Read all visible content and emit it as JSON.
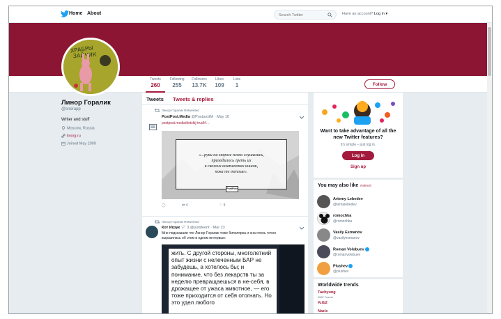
{
  "nav": {
    "home": "Home",
    "about": "About",
    "search_placeholder": "Search Twitter",
    "have_account": "Have an account?",
    "login": "Log in ▾"
  },
  "stats": [
    {
      "label": "Tweets",
      "value": "260"
    },
    {
      "label": "Following",
      "value": "255"
    },
    {
      "label": "Followers",
      "value": "13.7K"
    },
    {
      "label": "Likes",
      "value": "109"
    },
    {
      "label": "Lists",
      "value": "1"
    }
  ],
  "follow_label": "Follow",
  "profile": {
    "name": "Линор Горалик",
    "handle": "@snorapp",
    "bio": "Writer and stuff",
    "location": "Moscow, Russia",
    "website": "linorg.ru",
    "joined": "Joined May 2009"
  },
  "timeline": {
    "tab_tweets": "Tweets",
    "tab_replies": "Tweets & replies"
  },
  "tweet1": {
    "retweeted_by": "Линор Горалик Retweeted",
    "author": "PostPost.Media",
    "handle_date": "@PostpostM · May 16",
    "link": "postpost.media/detskij-trud/#…",
    "quote_line1": "«...руки на морозе плохо слушались,",
    "quote_line2": "приходилось греть их",
    "quote_line3": "в свежих комплектах кишок,",
    "quote_line4": "пока те теплые».",
    "quote_badge": "PostPost",
    "retweets": "4",
    "likes": "9"
  },
  "tweet2": {
    "retweeted_by": "Линор Горалик Retweeted",
    "author": "Кот Игрук",
    "handle_date": "🏳 3 @justdeerit · Mar 23",
    "text_line1": "Мне подсказали что Линор Горалик тоже биполярка и она очень точно",
    "text_line2": "выразилась об этом в одном интервью:",
    "card_text": "жить. С другой стороны, многолетний опыт жизни с нелеченным БАР не забудешь, а хотелось бы; и понимание, что без лекарств ты за неделю превращаешься в не-себя, в дрожащее от ужаса животное, — его тоже приходится от себя отогнать. Но это удел любого"
  },
  "signup": {
    "question": "Want to take advantage of all the new Twitter features?",
    "simple": "It's simple – just log in.",
    "login_button": "Log in",
    "signup_link": "Sign up"
  },
  "wtf": {
    "title": "You may also like",
    "refresh": "Refresh",
    "items": [
      {
        "name": "Artemy Lebedev",
        "handle": "@temalebedev"
      },
      {
        "name": "romochka",
        "handle": "@romochka"
      },
      {
        "name": "Vasily Esmanov",
        "handle": "@vasilyesmanov"
      },
      {
        "name": "Roman Volobuev",
        "handle": "@romanvolobuev"
      },
      {
        "name": "Plushev",
        "handle": "@plushev"
      }
    ]
  },
  "trends": {
    "title": "Worldwide trends",
    "items": [
      {
        "name": "Taehyung",
        "sub": "606K Tweets"
      },
      {
        "name": "#zib2",
        "sub": ""
      },
      {
        "name": "Nazis",
        "sub": ""
      }
    ]
  },
  "colors": {
    "brand": "#a31b3c",
    "banner": "#8b1533",
    "twitter_blue": "#1da1f2"
  }
}
